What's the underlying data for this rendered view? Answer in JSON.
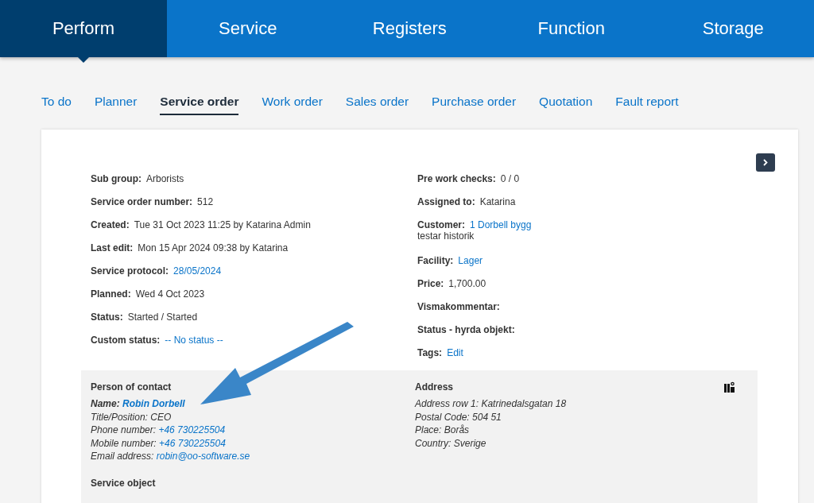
{
  "main_tabs": [
    {
      "label": "Perform",
      "selected": true
    },
    {
      "label": "Service",
      "selected": false
    },
    {
      "label": "Registers",
      "selected": false
    },
    {
      "label": "Function",
      "selected": false
    },
    {
      "label": "Storage",
      "selected": false
    }
  ],
  "sub_tabs": [
    {
      "label": "To do",
      "selected": false
    },
    {
      "label": "Planner",
      "selected": false
    },
    {
      "label": "Service order",
      "selected": true
    },
    {
      "label": "Work order",
      "selected": false
    },
    {
      "label": "Sales order",
      "selected": false
    },
    {
      "label": "Purchase order",
      "selected": false
    },
    {
      "label": "Quotation",
      "selected": false
    },
    {
      "label": "Fault report",
      "selected": false
    }
  ],
  "details_left": [
    {
      "label": "Sub group:",
      "value": "Arborists",
      "kind": "text"
    },
    {
      "label": "Service order number:",
      "value": "512",
      "kind": "text"
    },
    {
      "label": "Created:",
      "value": "Tue 31 Oct 2023 11:25 by Katarina Admin",
      "kind": "text"
    },
    {
      "label": "Last edit:",
      "value": "Mon 15 Apr 2024 09:38 by Katarina",
      "kind": "text"
    },
    {
      "label": "Service protocol:",
      "value": "28/05/2024",
      "kind": "link"
    },
    {
      "label": "Planned:",
      "value": "Wed 4 Oct 2023",
      "kind": "text"
    },
    {
      "label": "Status:",
      "value": "Started / Started",
      "kind": "text"
    },
    {
      "label": "Custom status:",
      "value": "-- No status --",
      "kind": "link"
    }
  ],
  "details_right": [
    {
      "label": "Pre work checks:",
      "value": "0 / 0",
      "kind": "text"
    },
    {
      "label": "Assigned to:",
      "value": "Katarina",
      "kind": "text"
    },
    {
      "label": "Customer:",
      "value": "1 Dorbell bygg",
      "kind": "link",
      "note": "testar historik"
    },
    {
      "label": "Facility:",
      "value": "Lager",
      "kind": "link"
    },
    {
      "label": "Price:",
      "value": "1,700.00",
      "kind": "text"
    },
    {
      "label": "Vismakommentar:",
      "kind": "empty"
    },
    {
      "label": "Status - hyrda objekt:",
      "kind": "empty"
    },
    {
      "label": "Tags:",
      "value": "Edit",
      "kind": "link"
    }
  ],
  "contact": {
    "title": "Person of contact",
    "rows": [
      {
        "label": "Name:",
        "value": "Robin Dorbell",
        "kind": "link",
        "bold": true
      },
      {
        "label": "Title/Position:",
        "value": "CEO",
        "kind": "text",
        "bold": false
      },
      {
        "label": "Phone number:",
        "value": "+46 730225504",
        "kind": "link",
        "bold": false
      },
      {
        "label": "Mobile number:",
        "value": "+46 730225504",
        "kind": "link",
        "bold": false
      },
      {
        "label": "Email address:",
        "value": "robin@oo-software.se",
        "kind": "link",
        "bold": false
      }
    ]
  },
  "address": {
    "title": "Address",
    "rows": [
      {
        "label": "Address row 1:",
        "value": "Katrinedalsgatan 18"
      },
      {
        "label": "Postal Code:",
        "value": "504 51"
      },
      {
        "label": "Place:",
        "value": "Borås"
      },
      {
        "label": "Country:",
        "value": "Sverige"
      }
    ]
  },
  "service_object": {
    "title": "Service object"
  }
}
